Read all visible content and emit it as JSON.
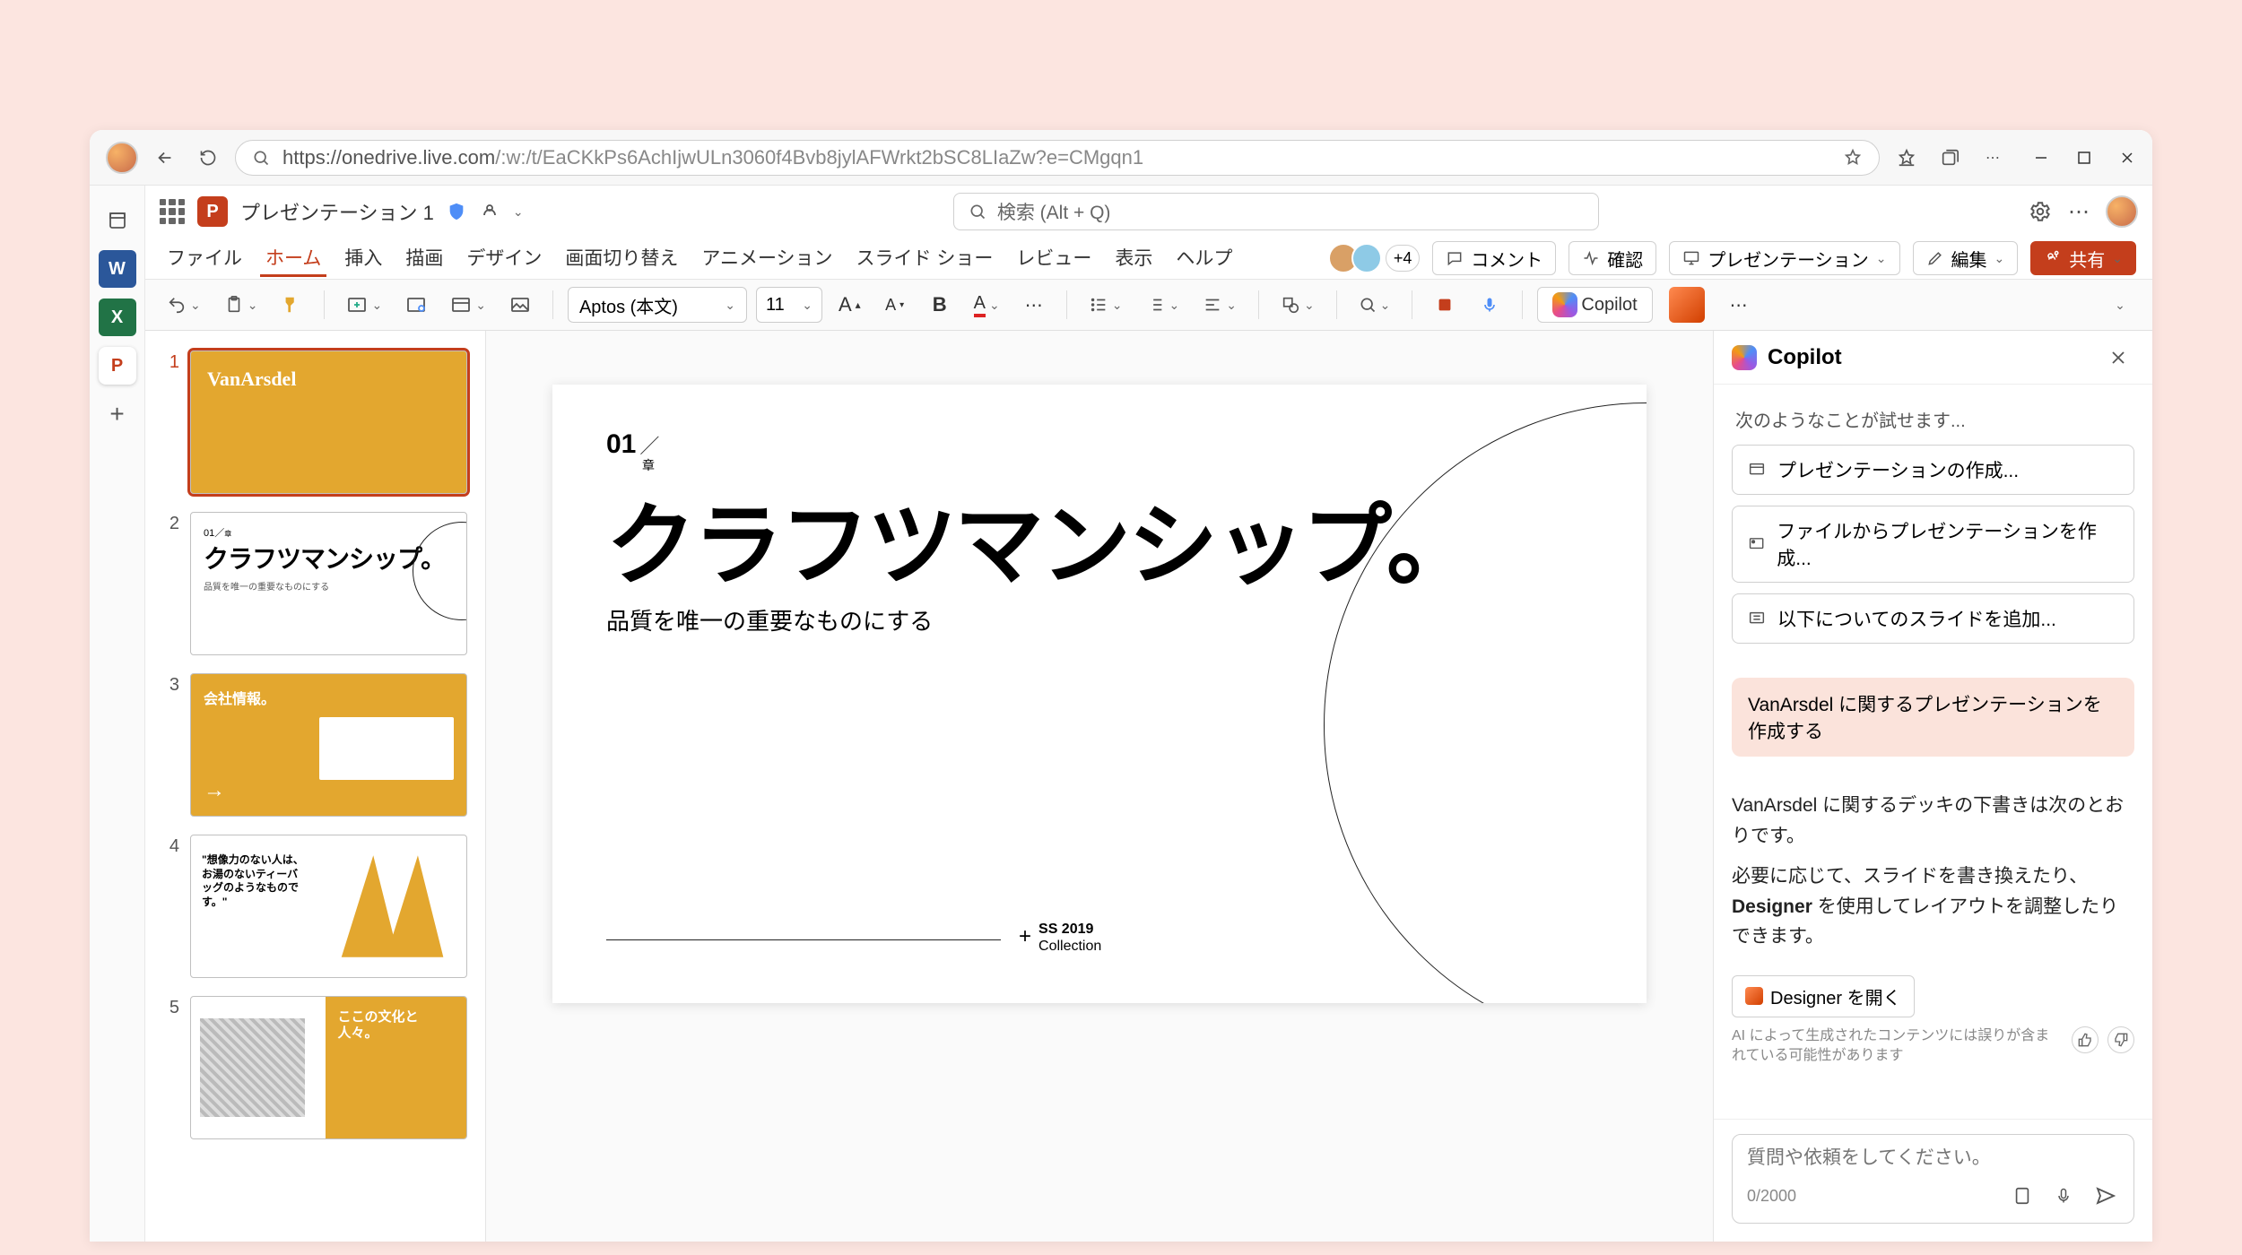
{
  "browser": {
    "url_host": "https://onedrive.live.com",
    "url_path": "/:w:/t/EaCKkPs6AchIjwULn3060f4Bvb8jylAFWrkt2bSC8LIaZw?e=CMgqn1"
  },
  "window": {
    "min": "–",
    "max": "▢",
    "close": "✕"
  },
  "title_row": {
    "doc_title": "プレゼンテーション 1",
    "search_placeholder": "検索 (Alt + Q)"
  },
  "menu": {
    "items": [
      "ファイル",
      "ホーム",
      "挿入",
      "描画",
      "デザイン",
      "画面切り替え",
      "アニメーション",
      "スライド ショー",
      "レビュー",
      "表示",
      "ヘルプ"
    ],
    "active_index": 1,
    "presence_extra": "+4",
    "comment": "コメント",
    "review": "確認",
    "present": "プレゼンテーション",
    "edit": "編集",
    "share": "共有"
  },
  "ribbon": {
    "font": "Aptos (本文)",
    "font_size": "11",
    "bold": "B",
    "copilot": "Copilot"
  },
  "thumbs": [
    {
      "n": "1",
      "kind": "title",
      "brand": "VanArsdel"
    },
    {
      "n": "2",
      "kind": "craft",
      "big": "クラフツマンシップ。",
      "sub": "品質を唯一の重要なものにする"
    },
    {
      "n": "3",
      "kind": "info",
      "heading": "会社情報。"
    },
    {
      "n": "4",
      "kind": "quote",
      "quote": "\"想像力のない人は、お湯のないティーバッグのようなものです。\""
    },
    {
      "n": "5",
      "kind": "culture",
      "heading": "ここの文化と人々。"
    }
  ],
  "slide": {
    "num": "01",
    "chapter": "章",
    "headline": "クラフツマンシップ。",
    "sub": "品質を唯一の重要なものにする",
    "foot_year": "SS 2019",
    "foot_label": "Collection"
  },
  "copilot": {
    "title": "Copilot",
    "hint": "次のようなことが試せます...",
    "chips": [
      "プレゼンテーションの作成...",
      "ファイルからプレゼンテーションを作成...",
      "以下についてのスライドを追加..."
    ],
    "user_msg": "VanArsdel に関するプレゼンテーションを作成する",
    "resp1": "VanArsdel に関するデッキの下書きは次のとおりです。",
    "resp2_a": "必要に応じて、スライドを書き換えたり、",
    "resp2_b": "Designer",
    "resp2_c": " を使用してレイアウトを調整したりできます。",
    "action": "Designer を開く",
    "disclaimer": "AI によって生成されたコンテンツには誤りが含まれている可能性があります",
    "placeholder": "質問や依頼をしてください。",
    "counter": "0/2000"
  }
}
